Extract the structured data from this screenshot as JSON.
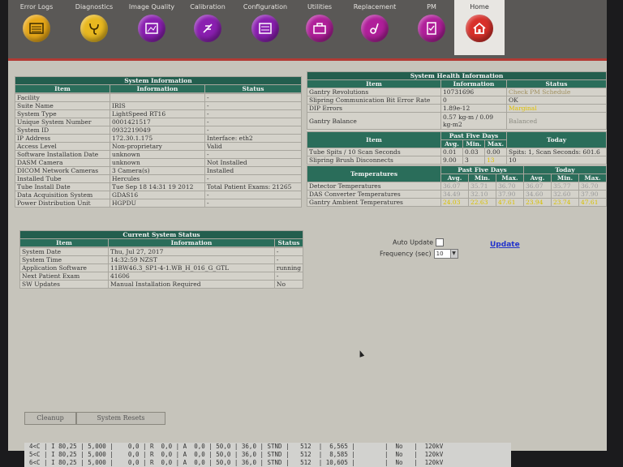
{
  "toolbar": {
    "items": [
      {
        "label": "Error Logs",
        "icon": "error-logs-icon",
        "color": "#e8a818"
      },
      {
        "label": "Diagnostics",
        "icon": "diagnostics-icon",
        "color": "#e8b820"
      },
      {
        "label": "Image Quality",
        "icon": "image-quality-icon",
        "color": "#8a1fb0"
      },
      {
        "label": "Calibration",
        "icon": "calibration-icon",
        "color": "#8a1fb0"
      },
      {
        "label": "Configuration",
        "icon": "configuration-icon",
        "color": "#8a1fb0"
      },
      {
        "label": "Utilities",
        "icon": "utilities-icon",
        "color": "#b01f9a"
      },
      {
        "label": "Replacement",
        "icon": "replacement-icon",
        "color": "#b01f9a"
      },
      {
        "label": "PM",
        "icon": "pm-icon",
        "color": "#b01f9a"
      },
      {
        "label": "Home",
        "icon": "home-icon",
        "color": "#d8302a"
      }
    ]
  },
  "system_info": {
    "title": "System Information",
    "headers": [
      "Item",
      "Information",
      "Status"
    ],
    "rows": [
      [
        "Facility",
        "",
        "-"
      ],
      [
        "Suite Name",
        "IRIS",
        "-"
      ],
      [
        "System Type",
        "LightSpeed RT16",
        "-"
      ],
      [
        "Unique System Number",
        "0001421517",
        "-"
      ],
      [
        "System ID",
        "0932219049",
        "-"
      ],
      [
        "IP Address",
        "172.30.1.175",
        "Interface: eth2"
      ],
      [
        "Access Level",
        "Non-proprietary",
        "Valid"
      ],
      [
        "Software Installation Date",
        "unknown",
        "-"
      ],
      [
        "DASM Camera",
        "unknown",
        "Not Installed"
      ],
      [
        "DICOM Network Cameras",
        "3 Camera(s)",
        "Installed"
      ],
      [
        "Installed Tube",
        "Hercules",
        "-"
      ],
      [
        "Tube Install Date",
        "Tue Sep 18 14:31 19 2012",
        "Total Patient Exams: 21265"
      ],
      [
        "Data Acquisition System",
        "GDAS16",
        "-"
      ],
      [
        "Power Distribution Unit",
        "HGPDU",
        "-"
      ]
    ]
  },
  "current_status": {
    "title": "Current System Status",
    "headers": [
      "Item",
      "Information",
      "Status"
    ],
    "rows": [
      [
        "System Date",
        "Thu, Jul 27, 2017",
        "-"
      ],
      [
        "System Time",
        "14:32:59 NZST",
        "-"
      ],
      [
        "Application Software",
        "11BW46.3_SP1-4-1.WB_H_016_G_GTL",
        "running"
      ],
      [
        "Next Patient Exam",
        "41606",
        "-"
      ],
      [
        "SW Updates",
        "Manual Installation Required",
        "No"
      ]
    ]
  },
  "health_info": {
    "title": "System Health Information",
    "headers": [
      "Item",
      "Information",
      "Status"
    ],
    "rows": [
      [
        "Gantry Revolutions",
        "10731696",
        "Check PM Schedule"
      ],
      [
        "Slipring Communication Bit Error Rate",
        "0",
        "OK"
      ],
      [
        "DIP Errors",
        "1.89e-12",
        "Marginal"
      ],
      [
        "Gantry Balance",
        "0.57 kg-m / 0.09 kg-m2",
        "Balanced"
      ]
    ],
    "past_header": {
      "item": "Item",
      "past": "Past Five Days",
      "today": "Today",
      "avg": "Avg.",
      "min": "Min.",
      "max": "Max."
    },
    "spit_rows": [
      {
        "item": "Tube Spits / 10 Scan Seconds",
        "avg": "0.01",
        "min": "0.03",
        "max": "0.00",
        "today": "Spits: 1, Scan Seconds: 601.6"
      },
      {
        "item": "Slipring Brush Disconnects",
        "avg": "9.00",
        "min": "3",
        "max": "13",
        "today": "10"
      }
    ],
    "temp_header": {
      "item": "Temperatures",
      "past": "Past Five Days",
      "today": "Today",
      "avg": "Avg.",
      "min": "Min.",
      "max": "Max."
    },
    "temp_rows": [
      {
        "item": "Detector Temperatures",
        "p_avg": "36.07",
        "p_min": "35.71",
        "p_max": "36.70",
        "t_avg": "36.07",
        "t_min": "35.77",
        "t_max": "36.70"
      },
      {
        "item": "DAS Converter Temperatures",
        "p_avg": "34.49",
        "p_min": "32.10",
        "p_max": "37.90",
        "t_avg": "34.60",
        "t_min": "32.60",
        "t_max": "37.90"
      },
      {
        "item": "Gantry Ambient Temperatures",
        "p_avg": "24.03",
        "p_min": "22.63",
        "p_max": "47.61",
        "t_avg": "23.94",
        "t_min": "23.74",
        "t_max": "47.61"
      }
    ]
  },
  "controls": {
    "auto_update_label": "Auto Update",
    "frequency_label": "Frequency (sec)",
    "frequency_value": "10",
    "update_link": "Update"
  },
  "buttons": {
    "cleanup": "Cleanup",
    "system_resets": "System Resets"
  },
  "terminal": {
    "lines": [
      "4<C | I 80,25 | 5,000 |    0,0 | R  0,0 | A  0,0 | 50,0 | 36,0 | STND |   512  |  6,565 |        |  No   |  120kV",
      "5<C | I 80,25 | 5,000 |    0,0 | R  0,0 | A  0,0 | 50,0 | 36,0 | STND |   512  |  8,585 |        |  No   |  120kV",
      "6<C | I 80,25 | 5,000 |    0,0 | R  0,0 | A  0,0 | 50,0 | 36,0 | STND |   512  | 10,605 |        |  No   |  120kV"
    ]
  }
}
